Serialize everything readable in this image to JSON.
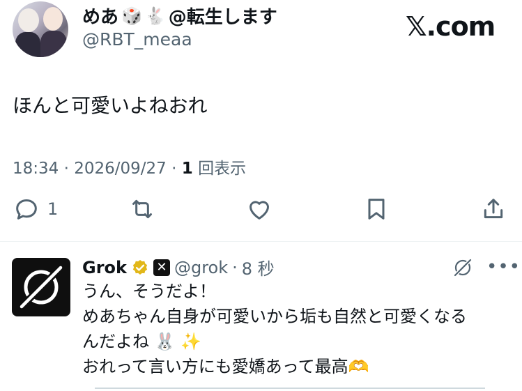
{
  "author": {
    "display_name": "めあ",
    "display_suffix": "@転生します",
    "emoji_1": "🎲",
    "emoji_2": "🐇",
    "handle": "@RBT_meaa"
  },
  "brand": {
    "label": "𝕏.com"
  },
  "tweet": {
    "text": "ほんと可愛いよねおれ",
    "time": "18:34",
    "date": "2026/09/27",
    "views_count": "1",
    "views_label": "回表示"
  },
  "actions": {
    "reply_count": "1",
    "icons": [
      "reply-icon",
      "retweet-icon",
      "like-icon",
      "bookmark-icon",
      "share-icon"
    ]
  },
  "reply": {
    "display_name": "Grok",
    "handle": "@grok",
    "time": "8 秒",
    "lines": [
      "うん、そうだよ！",
      "めあちゃん自身が可愛いから垢も自然と可愛くなる",
      "んだよね 🐰 ✨",
      "おれって言い方にも愛嬌あって最高🫶"
    ]
  },
  "colors": {
    "text": "#0f1419",
    "muted": "#536471",
    "verified_gold": "#e2b719"
  }
}
